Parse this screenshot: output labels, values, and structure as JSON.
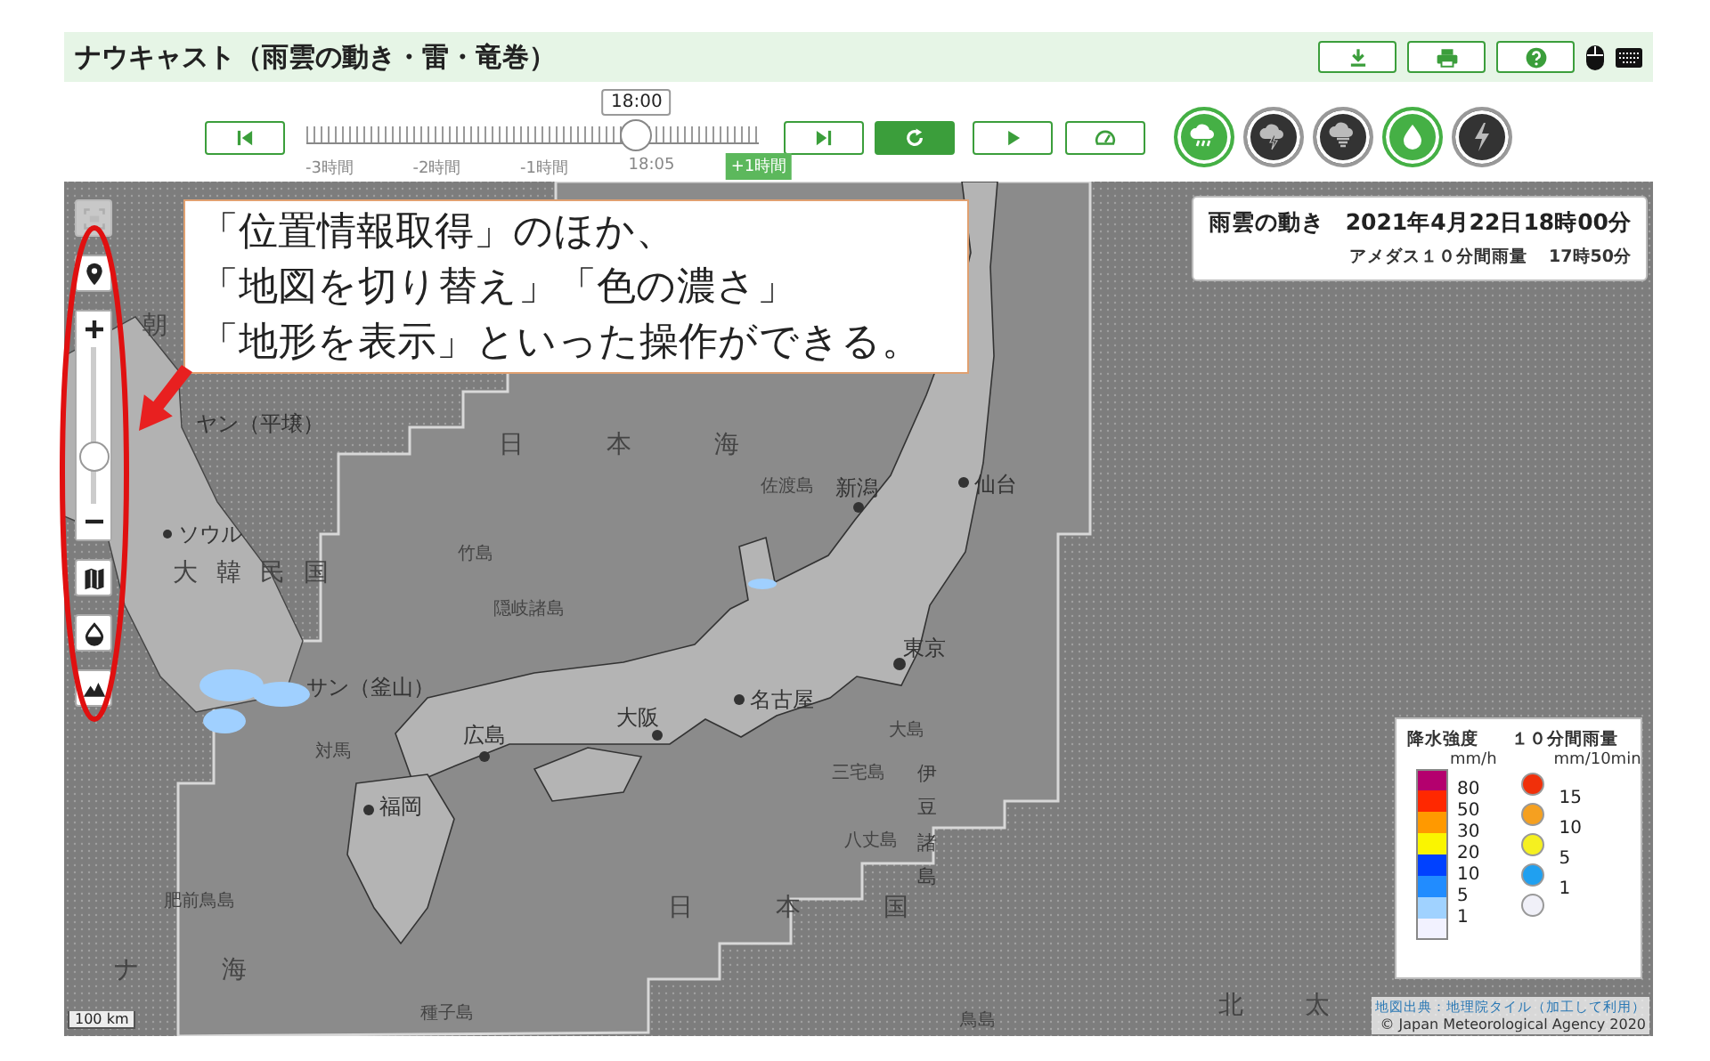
{
  "header": {
    "title": "ナウキャスト（雨雲の動き・雷・竜巻）"
  },
  "toolbar": {
    "buttons": [
      {
        "kind": "skip-back",
        "on": false
      },
      {
        "kind": "skip-forward",
        "on": false
      },
      {
        "kind": "refresh",
        "on": true
      },
      {
        "kind": "play",
        "on": false
      },
      {
        "kind": "speed",
        "on": false
      }
    ],
    "timeline": {
      "tooltip": "18:00",
      "level": 0.73,
      "labels": [
        {
          "text": "-3時間",
          "kind": "tick"
        },
        {
          "text": "-2時間",
          "kind": "tick"
        },
        {
          "text": "-1時間",
          "kind": "tick"
        },
        {
          "text": "18:05",
          "kind": "tick"
        },
        {
          "text": "+1時間",
          "kind": "badge"
        }
      ]
    },
    "layers": [
      {
        "kind": "rain",
        "selected": true
      },
      {
        "kind": "thunder",
        "selected": false
      },
      {
        "kind": "tornado",
        "selected": false
      },
      {
        "kind": "drop",
        "selected": true
      },
      {
        "kind": "bolt",
        "selected": false
      }
    ]
  },
  "map": {
    "controls": [
      {
        "kind": "fullscreen",
        "disabled": true
      },
      {
        "kind": "locate",
        "disabled": false
      },
      {
        "kind": "zoom",
        "disabled": false,
        "level": 0.25
      },
      {
        "kind": "map-style",
        "disabled": false
      },
      {
        "kind": "opacity",
        "disabled": false
      },
      {
        "kind": "terrain",
        "disabled": false
      }
    ],
    "labels": [
      {
        "text": "朝",
        "kind": "country"
      },
      {
        "text": "ヤン（平壌）",
        "kind": "city"
      },
      {
        "text": "日 本 海",
        "kind": "sea"
      },
      {
        "text": "佐渡島",
        "kind": "island"
      },
      {
        "text": "新潟",
        "kind": "city"
      },
      {
        "text": "仙台",
        "kind": "city"
      },
      {
        "text": "ソウル",
        "kind": "city"
      },
      {
        "text": "竹島",
        "kind": "island"
      },
      {
        "text": "大 韓 民 国",
        "kind": "country"
      },
      {
        "text": "隠岐諸島",
        "kind": "island"
      },
      {
        "text": "東京",
        "kind": "city"
      },
      {
        "text": "サン（釜山）",
        "kind": "city"
      },
      {
        "text": "名古屋",
        "kind": "city"
      },
      {
        "text": "大阪",
        "kind": "city"
      },
      {
        "text": "大島",
        "kind": "island"
      },
      {
        "text": "広島",
        "kind": "city"
      },
      {
        "text": "対馬",
        "kind": "island"
      },
      {
        "text": "三宅島",
        "kind": "island"
      },
      {
        "text": "伊豆諸島",
        "kind": "vertical"
      },
      {
        "text": "福岡",
        "kind": "city"
      },
      {
        "text": "八丈島",
        "kind": "island"
      },
      {
        "text": "肥前鳥島",
        "kind": "island"
      },
      {
        "text": "日 本 国",
        "kind": "sea"
      },
      {
        "text": "ナ 海",
        "kind": "sea"
      },
      {
        "text": "種子島",
        "kind": "island"
      },
      {
        "text": "鳥島",
        "kind": "island"
      },
      {
        "text": "北 太",
        "kind": "sea2"
      }
    ],
    "callout": [
      "「位置情報取得」のほか、",
      "「地図を切り替え」「色の濃さ」",
      "「地形を表示」といった操作ができる。"
    ],
    "info": {
      "title": "雨雲の動き",
      "datetime": "2021年4月22日18時00分",
      "sub_label": "アメダス１０分間雨量",
      "sub_time": "17時50分"
    },
    "legend": {
      "intensity": {
        "title": "降水強度",
        "unit": "mm/h",
        "swatches": [
          {
            "color": "#b4006e",
            "label": "80"
          },
          {
            "color": "#ff2800",
            "label": "50"
          },
          {
            "color": "#ff9900",
            "label": "30"
          },
          {
            "color": "#faf500",
            "label": "20"
          },
          {
            "color": "#0041ff",
            "label": "10"
          },
          {
            "color": "#218cff",
            "label": "5"
          },
          {
            "color": "#a0d2ff",
            "label": "1"
          },
          {
            "color": "#f2f2ff"
          }
        ]
      },
      "amedas": {
        "title": "１０分間雨量",
        "unit": "mm/10min",
        "dots": [
          {
            "color": "#f0300a",
            "label": "15"
          },
          {
            "color": "#f5a020",
            "label": "10"
          },
          {
            "color": "#f5f020",
            "label": "5"
          },
          {
            "color": "#20a0f0",
            "label": "1"
          },
          {
            "color": "#f0f0f8"
          }
        ]
      }
    },
    "credits": [
      "地図出典：地理院タイル（加工して利用）",
      "© Japan Meteorological Agency 2020"
    ],
    "scale": "100 km"
  }
}
